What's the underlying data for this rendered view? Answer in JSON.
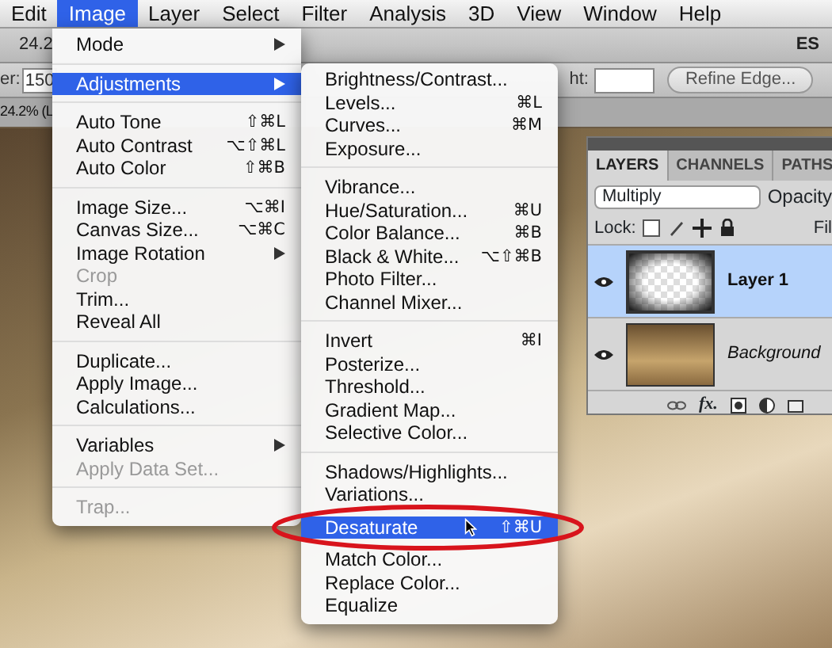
{
  "menu_bar": [
    {
      "label": "Edit",
      "selected": false
    },
    {
      "label": "Image",
      "selected": true
    },
    {
      "label": "Layer",
      "selected": false
    },
    {
      "label": "Select",
      "selected": false
    },
    {
      "label": "Filter",
      "selected": false
    },
    {
      "label": "Analysis",
      "selected": false
    },
    {
      "label": "3D",
      "selected": false
    },
    {
      "label": "View",
      "selected": false
    },
    {
      "label": "Window",
      "selected": false
    },
    {
      "label": "Help",
      "selected": false
    }
  ],
  "options_bar": {
    "zoom_text": "24.2",
    "workspace_text": "ES",
    "feather_label": "er:",
    "feather_value": "150",
    "height_label": "ht:",
    "refine_button": "Refine Edge..."
  },
  "document_tab": {
    "title": "24.2% (L"
  },
  "image_menu": {
    "sections": [
      [
        {
          "label": "Mode",
          "has_submenu": true,
          "disabled": false,
          "selected": false
        }
      ],
      [
        {
          "label": "Adjustments",
          "has_submenu": true,
          "disabled": false,
          "selected": true
        }
      ],
      [
        {
          "label": "Auto Tone",
          "shortcut": "⇧⌘L",
          "has_submenu": false,
          "disabled": false,
          "selected": false
        },
        {
          "label": "Auto Contrast",
          "shortcut": "⌥⇧⌘L",
          "has_submenu": false,
          "disabled": false,
          "selected": false
        },
        {
          "label": "Auto Color",
          "shortcut": "⇧⌘B",
          "has_submenu": false,
          "disabled": false,
          "selected": false
        }
      ],
      [
        {
          "label": "Image Size...",
          "shortcut": "⌥⌘I",
          "has_submenu": false,
          "disabled": false,
          "selected": false
        },
        {
          "label": "Canvas Size...",
          "shortcut": "⌥⌘C",
          "has_submenu": false,
          "disabled": false,
          "selected": false
        },
        {
          "label": "Image Rotation",
          "has_submenu": true,
          "disabled": false,
          "selected": false
        },
        {
          "label": "Crop",
          "has_submenu": false,
          "disabled": true,
          "selected": false
        },
        {
          "label": "Trim...",
          "has_submenu": false,
          "disabled": false,
          "selected": false
        },
        {
          "label": "Reveal All",
          "has_submenu": false,
          "disabled": false,
          "selected": false
        }
      ],
      [
        {
          "label": "Duplicate...",
          "has_submenu": false,
          "disabled": false,
          "selected": false
        },
        {
          "label": "Apply Image...",
          "has_submenu": false,
          "disabled": false,
          "selected": false
        },
        {
          "label": "Calculations...",
          "has_submenu": false,
          "disabled": false,
          "selected": false
        }
      ],
      [
        {
          "label": "Variables",
          "has_submenu": true,
          "disabled": false,
          "selected": false
        },
        {
          "label": "Apply Data Set...",
          "has_submenu": false,
          "disabled": true,
          "selected": false
        }
      ],
      [
        {
          "label": "Trap...",
          "has_submenu": false,
          "disabled": true,
          "selected": false
        }
      ]
    ]
  },
  "adjustments_submenu": {
    "sections": [
      [
        {
          "label": "Brightness/Contrast...",
          "disabled": false,
          "selected": false
        },
        {
          "label": "Levels...",
          "shortcut": "⌘L",
          "disabled": false,
          "selected": false
        },
        {
          "label": "Curves...",
          "shortcut": "⌘M",
          "disabled": false,
          "selected": false
        },
        {
          "label": "Exposure...",
          "disabled": false,
          "selected": false
        }
      ],
      [
        {
          "label": "Vibrance...",
          "disabled": false,
          "selected": false
        },
        {
          "label": "Hue/Saturation...",
          "shortcut": "⌘U",
          "disabled": false,
          "selected": false
        },
        {
          "label": "Color Balance...",
          "shortcut": "⌘B",
          "disabled": false,
          "selected": false
        },
        {
          "label": "Black & White...",
          "shortcut": "⌥⇧⌘B",
          "disabled": false,
          "selected": false
        },
        {
          "label": "Photo Filter...",
          "disabled": false,
          "selected": false
        },
        {
          "label": "Channel Mixer...",
          "disabled": false,
          "selected": false
        }
      ],
      [
        {
          "label": "Invert",
          "shortcut": "⌘I",
          "disabled": false,
          "selected": false
        },
        {
          "label": "Posterize...",
          "disabled": false,
          "selected": false
        },
        {
          "label": "Threshold...",
          "disabled": false,
          "selected": false
        },
        {
          "label": "Gradient Map...",
          "disabled": false,
          "selected": false
        },
        {
          "label": "Selective Color...",
          "disabled": false,
          "selected": false
        }
      ],
      [
        {
          "label": "Shadows/Highlights...",
          "disabled": false,
          "selected": false
        },
        {
          "label": "Variations...",
          "disabled": false,
          "selected": false
        },
        {
          "label": "Desaturate",
          "shortcut": "⇧⌘U",
          "disabled": false,
          "selected": true
        },
        {
          "label": "Match Color...",
          "disabled": false,
          "selected": false
        },
        {
          "label": "Replace Color...",
          "disabled": false,
          "selected": false
        },
        {
          "label": "Equalize",
          "disabled": false,
          "selected": false
        }
      ]
    ]
  },
  "layers_panel": {
    "tabs": [
      {
        "label": "LAYERS",
        "selected": true
      },
      {
        "label": "CHANNELS",
        "selected": false
      },
      {
        "label": "PATHS",
        "selected": false
      }
    ],
    "blend_mode": "Multiply",
    "opacity_label": "Opacity",
    "lock_label": "Lock:",
    "fill_label": "Fil",
    "layers": [
      {
        "name": "Layer 1",
        "kind": "transparent",
        "visible": true,
        "selected": true,
        "italic": false
      },
      {
        "name": "Background",
        "kind": "photo",
        "visible": true,
        "selected": false,
        "italic": true
      }
    ],
    "footer_fx": "fx."
  }
}
